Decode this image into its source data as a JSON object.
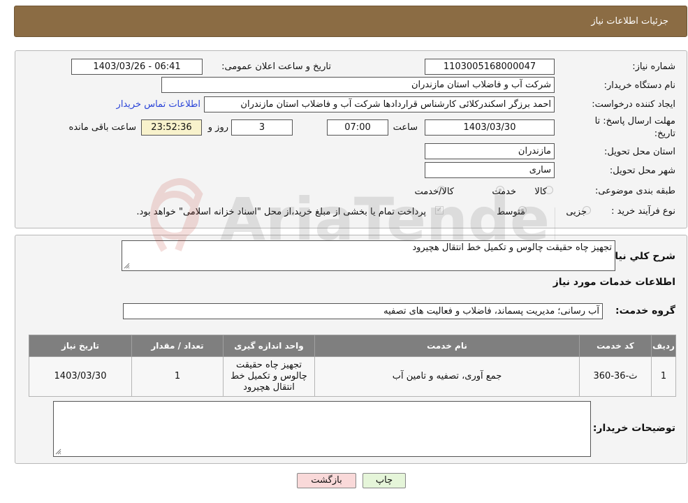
{
  "header": {
    "title": "جزئیات اطلاعات نیاز"
  },
  "form": {
    "need_number_label": "شماره نیاز:",
    "need_number": "1103005168000047",
    "announce_label": "تاریخ و ساعت اعلان عمومی:",
    "announce_value": "1403/03/26 - 06:41",
    "buyer_org_label": "نام دستگاه خریدار:",
    "buyer_org": "شرکت آب و فاضلاب استان مازندران",
    "creator_label": "ایجاد کننده درخواست:",
    "creator": "احمد برزگر اسکندرکلائی کارشناس قراردادها شرکت آب و فاضلاب استان مازندران",
    "contact_link": "اطلاعات تماس خریدار",
    "deadline_label_1": "مهلت ارسال پاسخ: تا",
    "deadline_label_2": "تاریخ:",
    "deadline_date": "1403/03/30",
    "time_label": "ساعت",
    "deadline_time": "07:00",
    "days": "3",
    "days_label": "روز و",
    "remaining": "23:52:36",
    "remaining_label": "ساعت باقی مانده",
    "province_label": "استان محل تحویل:",
    "province": "مازندران",
    "city_label": "شهر محل تحویل:",
    "city": "ساری",
    "category_label": "طبقه بندی موضوعی:",
    "category_options": [
      "کالا",
      "خدمت",
      "کالا/خدمت"
    ],
    "category_selected": "خدمت",
    "process_label": "نوع فرآیند خرید :",
    "process_options": [
      "جزیی",
      "متوسط"
    ],
    "process_selected": "متوسط",
    "treasury_note": "پرداخت تمام یا بخشی از مبلغ خرید،از محل \"اسناد خزانه اسلامی\" خواهد بود."
  },
  "details": {
    "summary_label": "شرح کلي نياز:",
    "summary": "تجهیز چاه حقیقت چالوس و تکمیل خط انتقال هچیرود",
    "services_title": "اطلاعات خدمات مورد نیاز",
    "service_group_label": "گروه خدمت:",
    "service_group": "آب رسانی؛ مدیریت پسماند، فاضلاب و فعالیت های تصفیه",
    "table": {
      "headers": [
        "ردیف",
        "کد خدمت",
        "نام خدمت",
        "واحد اندازه گیری",
        "تعداد / مقدار",
        "تاریخ نیاز"
      ],
      "rows": [
        [
          "1",
          "ث-36-360",
          "جمع آوری، تصفیه و تامین آب",
          "تجهیز چاه حقیقت چالوس و تکمیل خط انتقال هچیرود",
          "1",
          "1403/03/30"
        ]
      ]
    },
    "buyer_notes_label": "توضیحات خریدار:",
    "buyer_notes": ""
  },
  "buttons": {
    "print": "چاپ",
    "back": "بازگشت"
  },
  "watermark": {
    "text": "AriaTender.neT"
  },
  "colors": {
    "header_bg": "#8b6c44",
    "link": "#2a44d8",
    "back_btn": "#f9d9d9",
    "print_btn": "#e5f5d9"
  }
}
